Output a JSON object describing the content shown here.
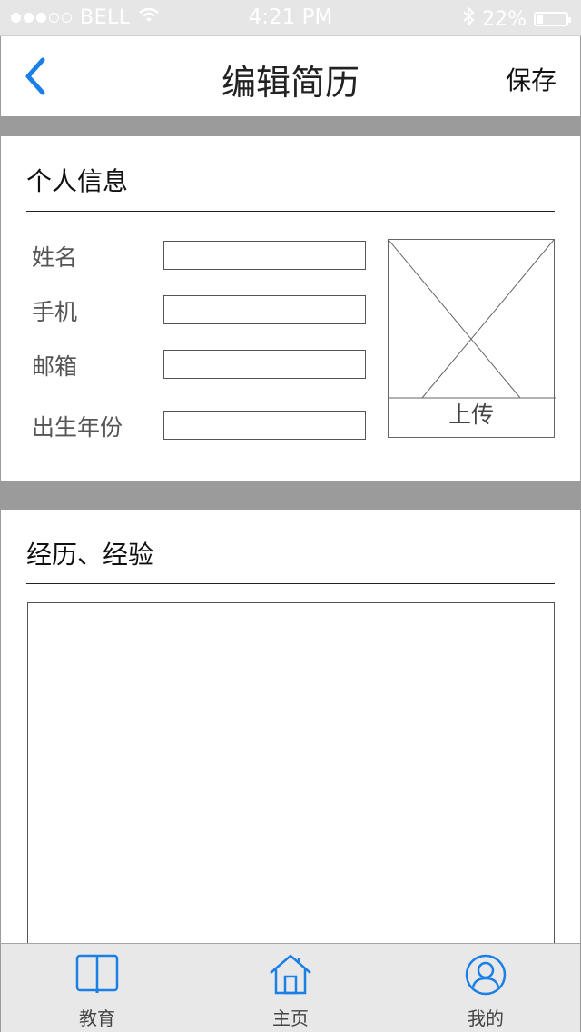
{
  "status_bar": {
    "carrier": "BELL",
    "time": "4:21 PM",
    "battery": "22%",
    "battery_level": 0.22,
    "signal_bars_filled": 3,
    "signal_bars_total": 5
  },
  "nav": {
    "title": "编辑简历",
    "save_label": "保存",
    "back_icon": "chevron-left-icon",
    "accent_color": "#1a7fe6"
  },
  "personal": {
    "title": "个人信息",
    "fields": [
      {
        "label": "姓名",
        "value": ""
      },
      {
        "label": "手机",
        "value": ""
      },
      {
        "label": "邮箱",
        "value": ""
      },
      {
        "label": "出生年份",
        "value": ""
      }
    ],
    "upload_label": "上传",
    "photo_icon": "image-placeholder-icon"
  },
  "experience": {
    "title": "经历、经验",
    "value": ""
  },
  "tabs": [
    {
      "label": "教育",
      "icon": "book-icon"
    },
    {
      "label": "主页",
      "icon": "home-icon"
    },
    {
      "label": "我的",
      "icon": "user-icon"
    }
  ]
}
